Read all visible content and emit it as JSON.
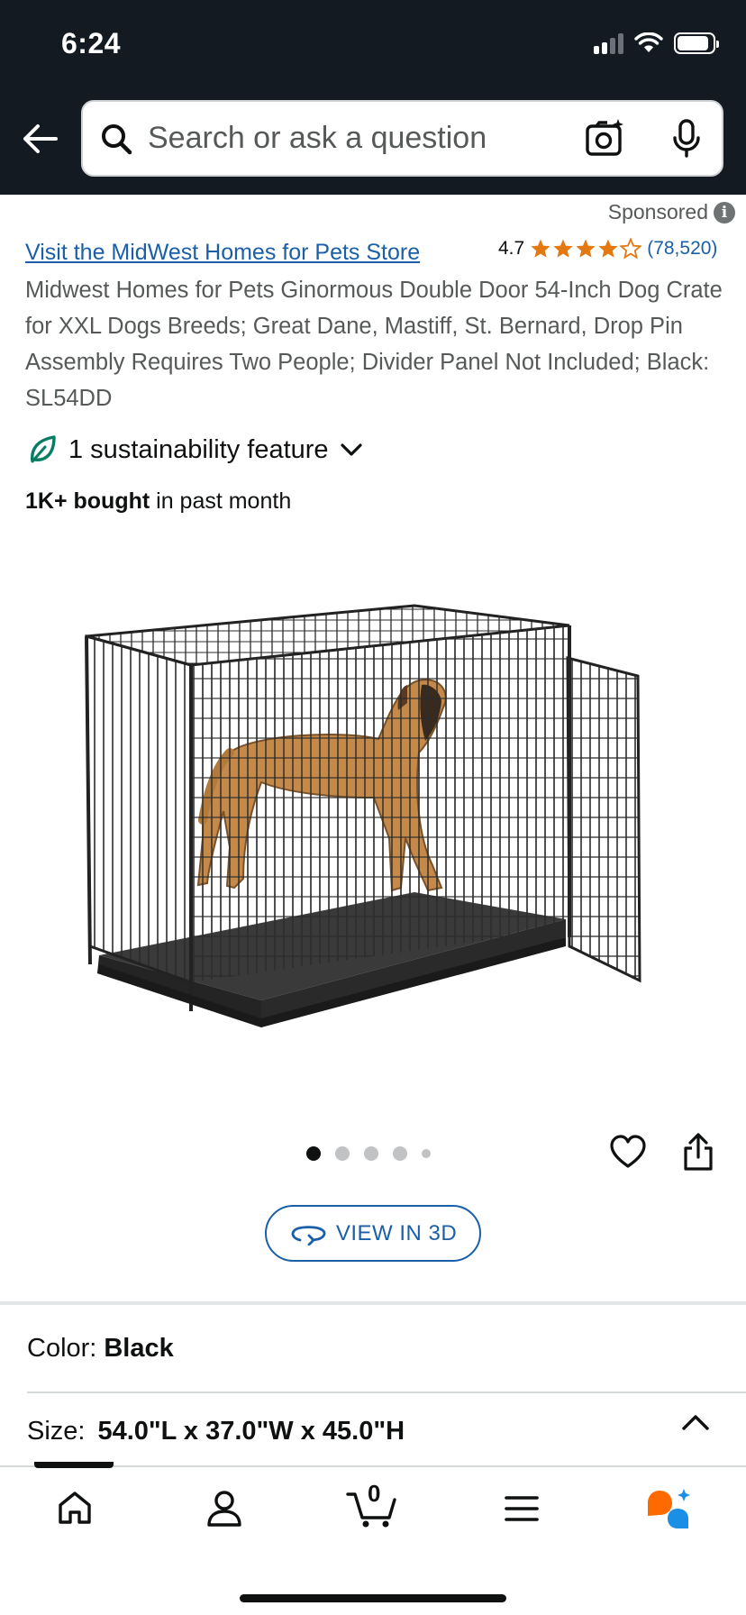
{
  "status_bar": {
    "time": "6:24"
  },
  "search": {
    "placeholder": "Search or ask a question"
  },
  "sponsored": "Sponsored",
  "product": {
    "store_link": "Visit the MidWest Homes for Pets Store",
    "rating": "4.7",
    "rating_count": "(78,520)",
    "title": "Midwest Homes for Pets Ginormous Double Door 54-Inch Dog Crate for XXL Dogs Breeds; Great Dane, Mastiff, St. Bernard, Drop Pin Assembly Requires Two People; Divider Panel Not Included; Black: SL54DD",
    "sustainability": "1 sustainability feature",
    "bought_bold": "1K+ bought",
    "bought_rest": " in past month",
    "image_count": 5,
    "active_image": 1
  },
  "view_3d_label": "VIEW IN 3D",
  "color": {
    "label": "Color:",
    "value": "Black"
  },
  "size": {
    "label": "Size:",
    "value": "54.0\"L x 37.0\"W x 45.0\"H"
  },
  "bottom_nav": {
    "cart_count": "0",
    "items": [
      "home",
      "account",
      "cart",
      "menu",
      "rufus"
    ]
  },
  "colors": {
    "header_bg": "#131a22",
    "link": "#1a5fa8",
    "star": "#e47911",
    "leaf": "#067d62"
  }
}
